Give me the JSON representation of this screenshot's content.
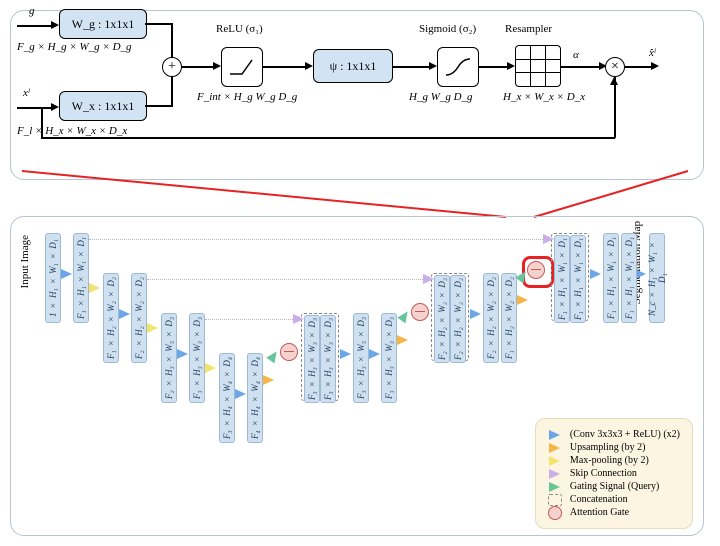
{
  "top": {
    "in_g": "g",
    "in_x": "xˡ",
    "Wg": "W_g : 1x1x1",
    "Wx": "W_x : 1x1x1",
    "Fg_dims": "F_g × H_g × W_g × D_g",
    "Fl_dims": "F_l × H_x × W_x × D_x",
    "relu": "ReLU (σ₁)",
    "Fint": "F_int × H_g W_g D_g",
    "psi": "ψ : 1x1x1",
    "sigmoid": "Sigmoid (σ₂)",
    "Hg_dims": "H_g W_g D_g",
    "resampler": "Resampler",
    "Hx_dims": "H_x × W_x × D_x",
    "alpha": "α",
    "out": "x̂ˡ"
  },
  "unet": {
    "input_label": "Input Image",
    "output_label": "Segmentation Map",
    "blocks": {
      "b0": "1 × H₁ × W₁ × D₁",
      "b1": "F₁ × H₁ × W₁ × D₁",
      "b2": "F₁ × H₂ × W₂ × D₂",
      "b3": "F₂ × H₂ × W₂ × D₂",
      "b4": "F₂ × H₃ × W₃ × D₃",
      "b5": "F₃ × H₃ × W₃ × D₃",
      "b6": "F₃ × H₄ × W₄ × D₄",
      "b7": "F₄ × H₄ × W₄ × D₄",
      "d3a": "F₃ × H₃ × W₃ × D₃",
      "d3b": "F₃ × H₃ × W₃ × D₃",
      "d3c": "F₃ × H₃ × W₃ × D₃",
      "d3d": "F₃ × H₃ × W₃ × D₃",
      "d2a": "F₂ × H₂ × W₂ × D₂",
      "d2b": "F₂ × H₂ × W₂ × D₂",
      "d2c": "F₂ × H₂ × W₂ × D₂",
      "d2d": "F₁ × H₂ × W₂ × D₂",
      "d1a": "F₁ × H₁ × W₁ × D₁",
      "d1b": "F₁ × H₁ × W₁ × D₁",
      "d1c": "F₁ × H₁ × W₁ × D₁",
      "out": "N_c × H₁ × W₁ × D₁"
    }
  },
  "legend": {
    "conv": "(Conv 3x3x3 + ReLU) (x2)",
    "upsamp": "Upsampling (by 2)",
    "maxpool": "Max-pooling (by 2)",
    "skip": "Skip Connection",
    "gate": "Gating Signal (Query)",
    "concat": "Concatenation",
    "ag": "Attention Gate"
  }
}
